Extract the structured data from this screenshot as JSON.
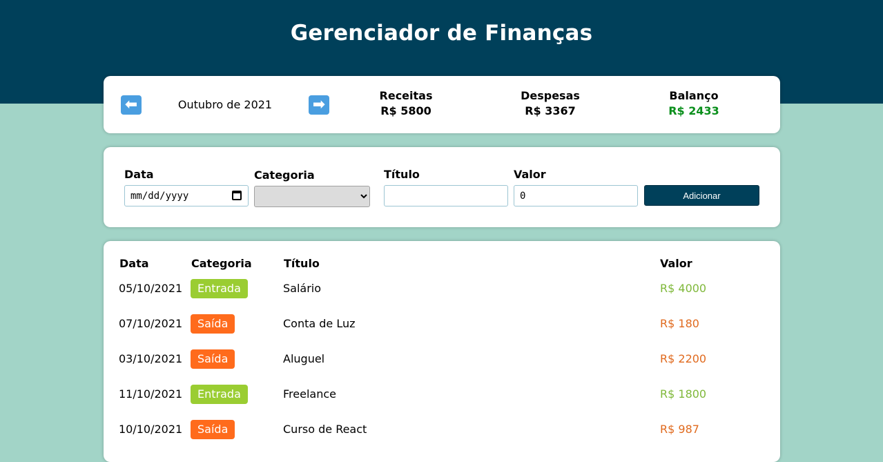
{
  "header": {
    "title": "Gerenciador de Finanças"
  },
  "info": {
    "prev_arrow": "⬅",
    "next_arrow": "➡",
    "month": "Outubro de 2021",
    "receitas_label": "Receitas",
    "receitas_value": "R$ 5800",
    "despesas_label": "Despesas",
    "despesas_value": "R$ 3367",
    "balanco_label": "Balanço",
    "balanco_value": "R$ 2433",
    "balanco_color": "#0a8f1c"
  },
  "form": {
    "data_label": "Data",
    "data_value": "mm/dd/yyyy",
    "categoria_label": "Categoria",
    "categoria_value": "",
    "titulo_label": "Título",
    "titulo_value": "",
    "valor_label": "Valor",
    "valor_value": "0",
    "add_button": "Adicionar"
  },
  "table": {
    "headers": {
      "data": "Data",
      "categoria": "Categoria",
      "titulo": "Título",
      "valor": "Valor"
    },
    "rows": [
      {
        "date": "05/10/2021",
        "category": "Entrada",
        "title": "Salário",
        "value": "R$ 4000",
        "type": "income"
      },
      {
        "date": "07/10/2021",
        "category": "Saída",
        "title": "Conta de Luz",
        "value": "R$ 180",
        "type": "expense"
      },
      {
        "date": "03/10/2021",
        "category": "Saída",
        "title": "Aluguel",
        "value": "R$ 2200",
        "type": "expense"
      },
      {
        "date": "11/10/2021",
        "category": "Entrada",
        "title": "Freelance",
        "value": "R$ 1800",
        "type": "income"
      },
      {
        "date": "10/10/2021",
        "category": "Saída",
        "title": "Curso de React",
        "value": "R$ 987",
        "type": "expense"
      }
    ]
  },
  "colors": {
    "header_bg": "#00405a",
    "page_bg": "#a2d4c7",
    "income": "#9acd32",
    "income_text": "#7fb83a",
    "expense": "#ff6b1c",
    "expense_text": "#e06a1e"
  }
}
